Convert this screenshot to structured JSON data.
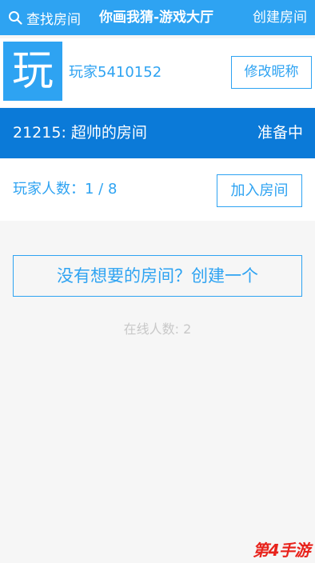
{
  "topbar": {
    "search_label": "查找房间",
    "title": "你画我猜-游戏大厅",
    "create_label": "创建房间",
    "search_icon": "search-icon"
  },
  "profile": {
    "avatar_char": "玩",
    "username": "玩家5410152",
    "rename_label": "修改昵称"
  },
  "room": {
    "name": "21215: 超帅的房间",
    "status": "准备中",
    "player_count": "玩家人数：1 / 8",
    "join_label": "加入房间"
  },
  "lobby": {
    "create_room_cta": "没有想要的房间？创建一个",
    "online_count": "在线人数: 2"
  },
  "watermark": "第4手游",
  "colors": {
    "accent": "#2ea3f2",
    "room_header": "#0b7ad8",
    "background": "#f6f6f6",
    "muted_text": "#c8c8c8",
    "watermark": "#e8231c"
  }
}
